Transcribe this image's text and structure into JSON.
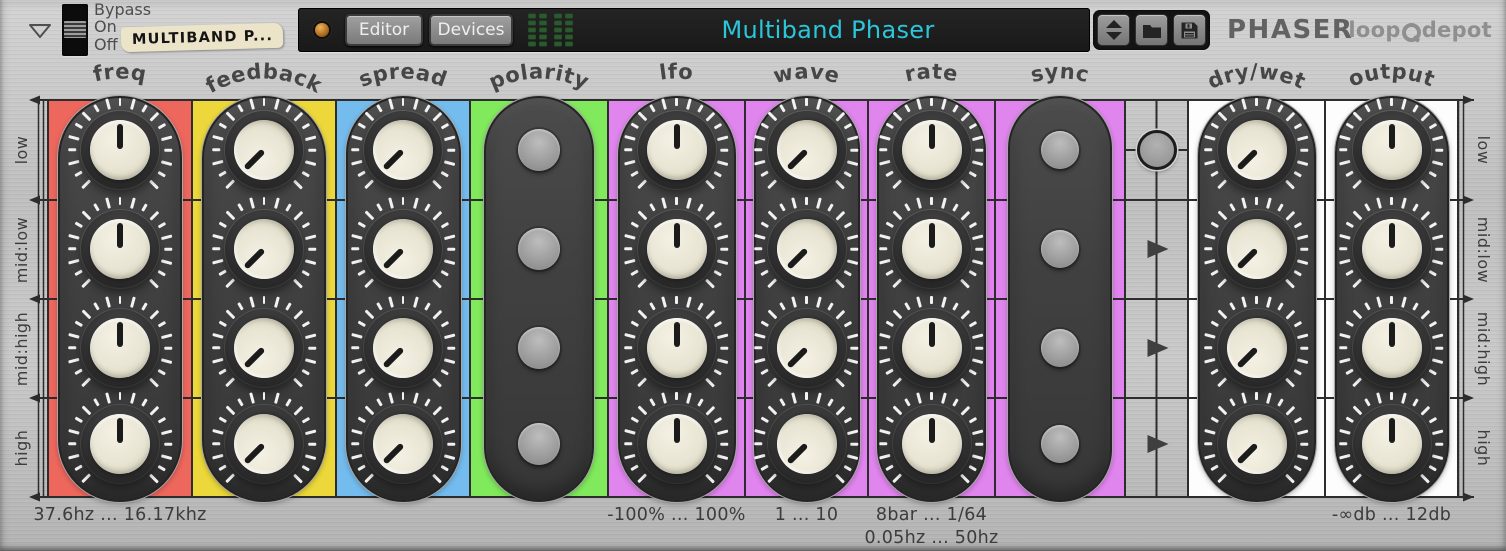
{
  "header": {
    "switch_labels": [
      "Bypass",
      "On",
      "Off"
    ],
    "preset_name": "MULTIBAND P...",
    "editor_label": "Editor",
    "devices_label": "Devices",
    "title": "Multiband Phaser",
    "title_color": "#2bc6d9",
    "device_name": "PHASER",
    "brand_left": "loop",
    "brand_right": "depot",
    "led_color": "#d89a3c",
    "meter_color": "#2c5a2f",
    "meter_groups": 2,
    "meter_columns_per_group": 2,
    "meter_segments_per_column": 5
  },
  "icons": {
    "disclosure": "triangle-down",
    "preset_prev_next": "up-down-arrows",
    "load_preset": "folder",
    "save_preset": "floppy-disk",
    "power_led": "amber-led",
    "link_arrow": "triangle-right"
  },
  "bands": [
    "low",
    "mid:low",
    "mid:high",
    "high"
  ],
  "columns": [
    {
      "id": "freq",
      "label": "freq",
      "type": "knob",
      "color": "#ed675d",
      "pointer_deg": 0,
      "range": "37.6hz ... 16.17khz",
      "range2": ""
    },
    {
      "id": "feedback",
      "label": "feedback",
      "type": "knob",
      "color": "#ecd83a",
      "pointer_deg": -135,
      "range": "",
      "range2": ""
    },
    {
      "id": "spread",
      "label": "spread",
      "type": "knob",
      "color": "#74bcee",
      "pointer_deg": -135,
      "range": "",
      "range2": ""
    },
    {
      "id": "polarity",
      "label": "polarity",
      "type": "button",
      "color": "#80e95c",
      "pointer_deg": 0,
      "range": "",
      "range2": ""
    },
    {
      "id": "lfo",
      "label": "lfo",
      "type": "knob",
      "color": "#e084ee",
      "pointer_deg": 0,
      "range": "-100% ... 100%",
      "range2": ""
    },
    {
      "id": "wave",
      "label": "wave",
      "type": "knob",
      "color": "#e084ee",
      "pointer_deg": -135,
      "range": "1 ... 10",
      "range2": ""
    },
    {
      "id": "rate",
      "label": "rate",
      "type": "knob",
      "color": "#e084ee",
      "pointer_deg": 0,
      "range": "8bar ... 1/64",
      "range2": "0.05hz ... 50hz"
    },
    {
      "id": "sync",
      "label": "sync",
      "type": "button",
      "color": "#e084ee",
      "pointer_deg": 0,
      "range": "",
      "range2": ""
    },
    {
      "id": "link",
      "label": "",
      "type": "link",
      "color": "",
      "pointer_deg": 0,
      "range": "",
      "range2": ""
    },
    {
      "id": "drywet",
      "label": "dry/wet",
      "type": "knob",
      "color": "#fdfdfd",
      "pointer_deg": -135,
      "range": "",
      "range2": ""
    },
    {
      "id": "output",
      "label": "output",
      "type": "knob",
      "color": "#fdfdfd",
      "pointer_deg": 0,
      "range": "-∞db ... 12db",
      "range2": ""
    }
  ]
}
